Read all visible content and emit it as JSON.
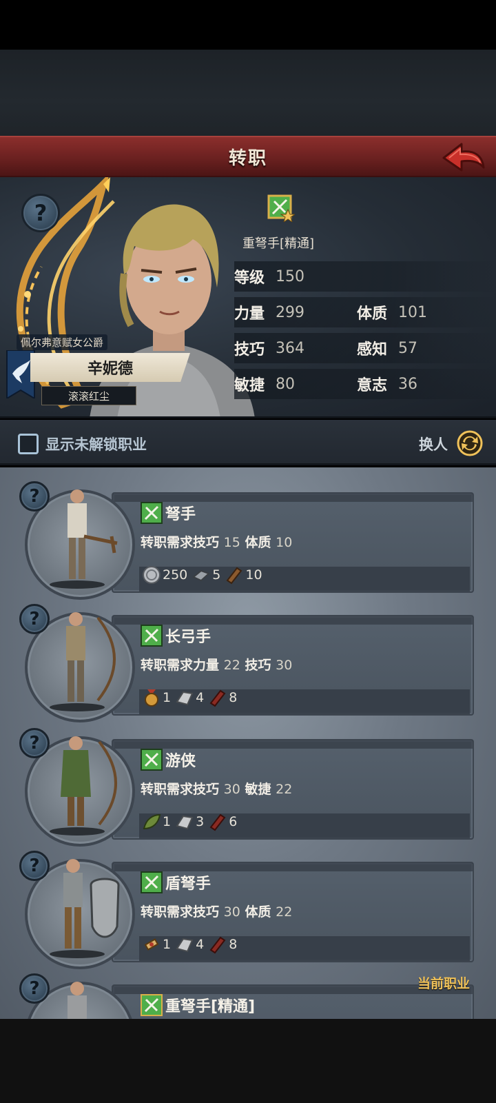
{
  "header": {
    "title": "转职"
  },
  "hero": {
    "current_class": "重弩手[精通]",
    "stats": {
      "level_label": "等级",
      "level": "150",
      "str_label": "力量",
      "str": "299",
      "con_label": "体质",
      "con": "101",
      "skill_label": "技巧",
      "skill": "364",
      "per_label": "感知",
      "per": "57",
      "agi_label": "敏捷",
      "agi": "80",
      "will_label": "意志",
      "will": "36"
    },
    "title": "佩尔弗意赋女公爵",
    "name": "辛妮德",
    "subtitle": "滚滚红尘",
    "help_icon": "?"
  },
  "filter": {
    "show_locked_label": "显示未解锁职业",
    "swap_label": "换人"
  },
  "classes": [
    {
      "name": "弩手",
      "req_prefix": "转职需求",
      "req1_label": "技巧",
      "req1_val": "15",
      "req2_label": "体质",
      "req2_val": "10",
      "res1": "250",
      "res2": "5",
      "res3": "10"
    },
    {
      "name": "长弓手",
      "req_prefix": "转职需求",
      "req1_label": "力量",
      "req1_val": "22",
      "req2_label": "技巧",
      "req2_val": "30",
      "res1": "1",
      "res2": "4",
      "res3": "8"
    },
    {
      "name": "游侠",
      "req_prefix": "转职需求",
      "req1_label": "技巧",
      "req1_val": "30",
      "req2_label": "敏捷",
      "req2_val": "22",
      "res1": "1",
      "res2": "3",
      "res3": "6"
    },
    {
      "name": "盾弩手",
      "req_prefix": "转职需求",
      "req1_label": "技巧",
      "req1_val": "30",
      "req2_label": "体质",
      "req2_val": "22",
      "res1": "1",
      "res2": "4",
      "res3": "8"
    },
    {
      "name": "重弩手[精通]",
      "current_label": "当前职业"
    }
  ],
  "colors": {
    "title_bar": "#6b2120",
    "accent_gold": "#f0c25a",
    "chip_green": "#4fae4a"
  }
}
